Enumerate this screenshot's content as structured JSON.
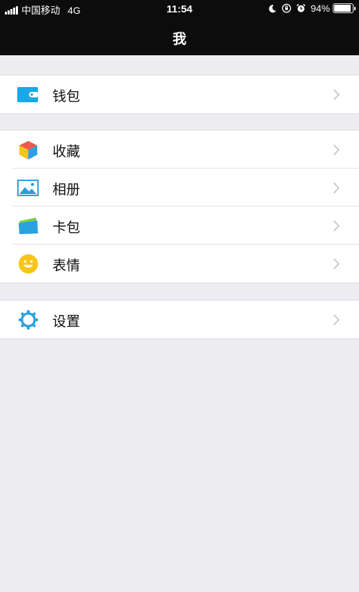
{
  "status_bar": {
    "carrier": "中国移动",
    "network": "4G",
    "time": "11:54",
    "battery": "94%",
    "battery_level": 0.94,
    "icons": [
      "moon-icon",
      "orientation-lock-icon",
      "alarm-icon"
    ]
  },
  "nav": {
    "title": "我"
  },
  "groups": [
    {
      "items": [
        {
          "label": "钱包",
          "icon": "wallet-icon"
        }
      ]
    },
    {
      "items": [
        {
          "label": "收藏",
          "icon": "favorites-cube-icon"
        },
        {
          "label": "相册",
          "icon": "album-icon"
        },
        {
          "label": "卡包",
          "icon": "card-pack-icon"
        },
        {
          "label": "表情",
          "icon": "emoji-face-icon"
        }
      ]
    },
    {
      "items": [
        {
          "label": "设置",
          "icon": "settings-gear-icon"
        }
      ]
    }
  ],
  "colors": {
    "nav_background": "#0c0c0c",
    "page_background": "#ececf1",
    "wallet_blue": "#1aa8e6",
    "emoji_yellow": "#f7c51a",
    "album_blue": "#2a9fe0",
    "card_green": "#7dd23e",
    "settings_blue": "#2ba2df",
    "chevron": "#c4c4c8"
  }
}
